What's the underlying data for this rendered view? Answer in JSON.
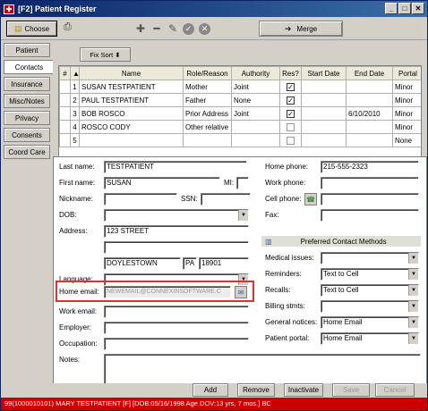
{
  "window": {
    "title": "[F2] Patient Register",
    "controls": [
      "_",
      "□",
      "✕"
    ]
  },
  "toolbar": {
    "choose_label": "Choose",
    "merge_label": "Merge"
  },
  "sidebar": {
    "items": [
      {
        "label": "Patient"
      },
      {
        "label": "Contacts"
      },
      {
        "label": "Insurance"
      },
      {
        "label": "Misc/Notes"
      },
      {
        "label": "Privacy"
      },
      {
        "label": "Consents"
      },
      {
        "label": "Coord Care"
      }
    ]
  },
  "grid": {
    "fix_sort_label": "Fix Sort",
    "columns": [
      "#",
      "Name",
      "Role/Reason",
      "Authority",
      "Res?",
      "Start Date",
      "End Date",
      "Portal"
    ],
    "rows": [
      {
        "num": "1",
        "name": "SUSAN  TESTPATIENT",
        "role": "Mother",
        "authority": "Joint",
        "res": true,
        "start": "",
        "end": "",
        "portal": "Minor"
      },
      {
        "num": "2",
        "name": "PAUL  TESTPATIENT",
        "role": "Father",
        "authority": "None",
        "res": true,
        "start": "",
        "end": "",
        "portal": "Minor"
      },
      {
        "num": "3",
        "name": "BOB  ROSCO",
        "role": "Prior Address",
        "authority": "Joint",
        "res": true,
        "start": "",
        "end": "6/10/2010",
        "portal": "Minor"
      },
      {
        "num": "4",
        "name": "ROSCO  CODY",
        "role": "Other relative",
        "authority": "",
        "res": false,
        "start": "",
        "end": "",
        "portal": "Minor"
      },
      {
        "num": "5",
        "name": "",
        "role": "",
        "authority": "",
        "res": false,
        "start": "",
        "end": "",
        "portal": "None"
      }
    ]
  },
  "form": {
    "last_name_label": "Last name:",
    "last_name": "TESTPATIENT",
    "first_name_label": "First name:",
    "first_name": "SUSAN",
    "mi_label": "MI:",
    "nickname_label": "Nickname:",
    "ssn_label": "SSN:",
    "dob_label": "DOB:",
    "address_label": "Address:",
    "address1": "123 STREET",
    "city": "DOYLESTOWN",
    "state": "PA",
    "zip": "18901",
    "language_label": "Language:",
    "home_email_label": "Home email:",
    "home_email": "NEWEMAIL@CONNEXINSOFTWARE.C",
    "work_email_label": "Work email:",
    "employer_label": "Employer:",
    "occupation_label": "Occupation:",
    "notes_label": "Notes:",
    "home_phone_label": "Home phone:",
    "home_phone": "215-555-2323",
    "work_phone_label": "Work phone:",
    "cell_phone_label": "Cell phone:",
    "fax_label": "Fax:",
    "pref_header": "Preferred Contact Methods",
    "medical_issues_label": "Medical issues:",
    "reminders_label": "Reminders:",
    "reminders_value": "Text to Cell",
    "recalls_label": "Recalls:",
    "recalls_value": "Text to Cell",
    "billing_label": "Billing stmts:",
    "general_label": "General notices:",
    "general_value": "Home Email",
    "portal_label": "Patient portal:",
    "portal_value": "Home Email"
  },
  "buttons": {
    "add": "Add",
    "remove": "Remove",
    "inactivate": "Inactivate",
    "save": "Save",
    "cancel": "Cancel"
  },
  "status": "99(1000010101) MARY TESTPATIENT [F] [DOB:05/16/1998 Age DOV:13 yrs, 7 mos.]  BC",
  "colors": {
    "status_bg": "#cc0000",
    "highlight": "#e03030",
    "titlebar": "#0a246a"
  }
}
